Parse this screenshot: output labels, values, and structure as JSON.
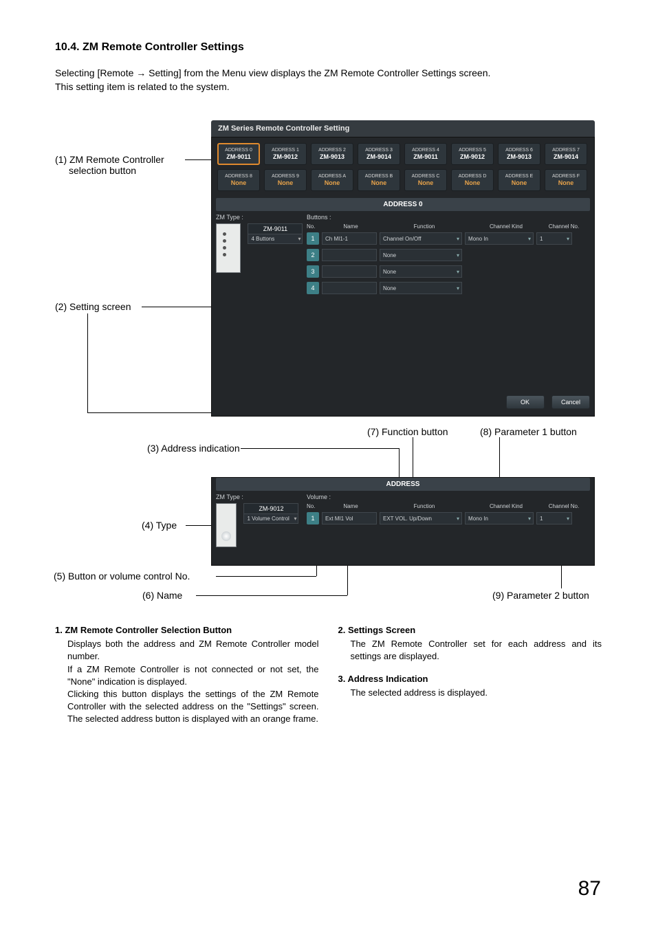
{
  "section_title": "10.4. ZM Remote Controller Settings",
  "intro_line1": "Selecting [Remote → Setting] from the Menu view displays the ZM Remote Controller Settings screen.",
  "intro_line2": "This setting item is related to the system.",
  "callouts": {
    "c1a": "(1) ZM Remote Controller",
    "c1b": "selection button",
    "c2": "(2) Setting screen",
    "c3": "(3) Address indication",
    "c4": "(4) Type",
    "c5": "(5) Button or volume control No.",
    "c6": "(6) Name",
    "c7": "(7) Function button",
    "c8": "(8) Parameter 1 button",
    "c9": "(9) Parameter 2 button"
  },
  "shot": {
    "title": "ZM Series Remote Controller Setting",
    "addresses": [
      {
        "addr": "ADDRESS 0",
        "val": "ZM-9011"
      },
      {
        "addr": "ADDRESS 1",
        "val": "ZM-9012"
      },
      {
        "addr": "ADDRESS 2",
        "val": "ZM-9013"
      },
      {
        "addr": "ADDRESS 3",
        "val": "ZM-9014"
      },
      {
        "addr": "ADDRESS 4",
        "val": "ZM-9011"
      },
      {
        "addr": "ADDRESS 5",
        "val": "ZM-9012"
      },
      {
        "addr": "ADDRESS 6",
        "val": "ZM-9013"
      },
      {
        "addr": "ADDRESS 7",
        "val": "ZM-9014"
      },
      {
        "addr": "ADDRESS 8",
        "val": "None"
      },
      {
        "addr": "ADDRESS 9",
        "val": "None"
      },
      {
        "addr": "ADDRESS A",
        "val": "None"
      },
      {
        "addr": "ADDRESS B",
        "val": "None"
      },
      {
        "addr": "ADDRESS C",
        "val": "None"
      },
      {
        "addr": "ADDRESS D",
        "val": "None"
      },
      {
        "addr": "ADDRESS E",
        "val": "None"
      },
      {
        "addr": "ADDRESS F",
        "val": "None"
      }
    ],
    "address_indicator": "ADDRESS  0",
    "zm_type_label": "ZM Type :",
    "type_name": "ZM-9011",
    "type_sel": "4 Buttons",
    "buttons_label": "Buttons :",
    "hdr": {
      "no": "No.",
      "name": "Name",
      "func": "Function",
      "p1": "Channel Kind",
      "p2": "Channel No."
    },
    "rows": [
      {
        "no": "1",
        "name": "Ch MI1-1",
        "func": "Channel On/Off",
        "p1": "Mono In",
        "p2": "1"
      },
      {
        "no": "2",
        "name": "",
        "func": "None"
      },
      {
        "no": "3",
        "name": "",
        "func": "None"
      },
      {
        "no": "4",
        "name": "",
        "func": "None"
      }
    ],
    "ok": "OK",
    "cancel": "Cancel"
  },
  "shot2": {
    "address_indicator": "ADDRESS",
    "zm_type_label": "ZM Type :",
    "type_name": "ZM-9012",
    "type_sel": "1 Volume Control",
    "vol_label": "Volume :",
    "hdr": {
      "no": "No.",
      "name": "Name",
      "func": "Function",
      "p1": "Channel Kind",
      "p2": "Channel No."
    },
    "rows": [
      {
        "no": "1",
        "name": "Ext MI1 Vol",
        "func": "EXT VOL. Up/Down",
        "p1": "Mono In",
        "p2": "1"
      }
    ]
  },
  "body": {
    "i1_title": "1. ZM Remote Controller Selection Button",
    "i1_p1": "Displays both the address and ZM Remote Controller model number.",
    "i1_p2": "If a ZM Remote Controller is not connected or not set, the \"None\" indication is displayed.",
    "i1_p3": "Clicking this button displays the settings of the ZM Remote Controller with the selected address on the \"Settings\" screen. The selected address button is displayed with an orange frame.",
    "i2_title": "2. Settings Screen",
    "i2_p1": "The ZM Remote Controller set for each address and its settings are displayed.",
    "i3_title": "3. Address Indication",
    "i3_p1": "The selected address is displayed."
  },
  "page_number": "87"
}
